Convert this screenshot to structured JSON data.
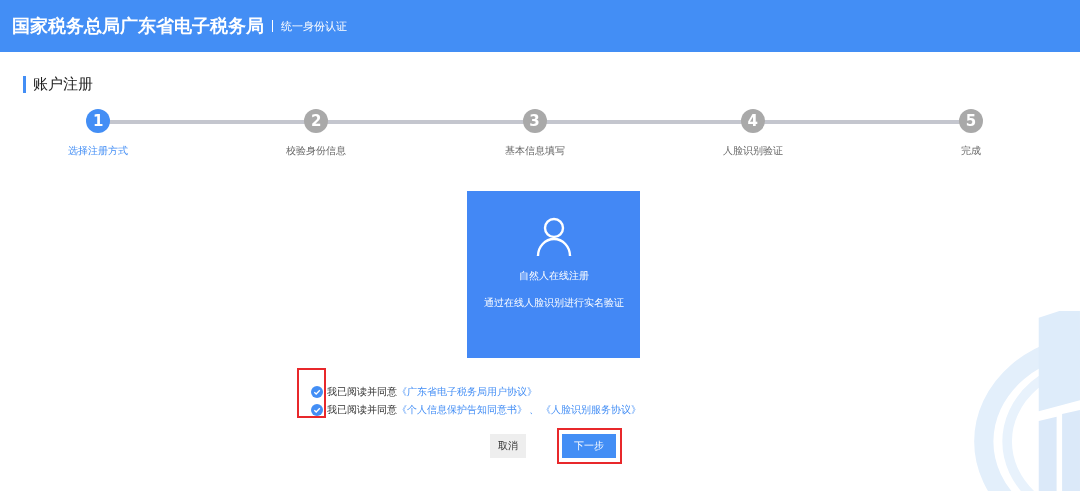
{
  "header": {
    "title": "国家税务总局广东省电子税务局",
    "subtitle": "统一身份认证"
  },
  "page_title": "账户注册",
  "steps": [
    {
      "number": "1",
      "label": "选择注册方式",
      "selected": true
    },
    {
      "number": "2",
      "label": "校验身份信息",
      "selected": false
    },
    {
      "number": "3",
      "label": "基本信息填写",
      "selected": false
    },
    {
      "number": "4",
      "label": "人脸识别验证",
      "selected": false
    },
    {
      "number": "5",
      "label": "完成",
      "selected": false
    }
  ],
  "option_card": {
    "title": "自然人在线注册",
    "description": "通过在线人脸识别进行实名验证"
  },
  "agreements_highlighted": true,
  "agreements": [
    {
      "checked": true,
      "text": "我已阅读并同意",
      "links": [
        "《广东省电子税务局用户协议》"
      ]
    },
    {
      "checked": true,
      "text": "我已阅读并同意",
      "links": [
        "《个人信息保护告知同意书》",
        "《人脸识别服务协议》"
      ],
      "separator": "、"
    }
  ],
  "buttons": [
    {
      "label": "取消",
      "kind": "secondary",
      "highlighted": false
    },
    {
      "label": "下一步",
      "kind": "primary",
      "highlighted": true
    }
  ]
}
